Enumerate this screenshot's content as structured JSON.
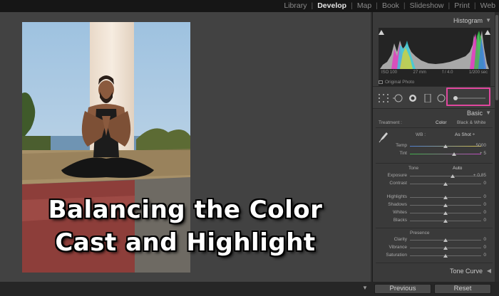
{
  "modules": [
    {
      "label": "Library",
      "active": false
    },
    {
      "label": "Develop",
      "active": true
    },
    {
      "label": "Map",
      "active": false
    },
    {
      "label": "Book",
      "active": false
    },
    {
      "label": "Slideshow",
      "active": false
    },
    {
      "label": "Print",
      "active": false
    },
    {
      "label": "Web",
      "active": false
    }
  ],
  "overlay": {
    "line1": "Balancing the Color",
    "line2": "Cast and Highlight"
  },
  "panel": {
    "histogram_title": "Histogram",
    "exif": {
      "iso": "ISO 100",
      "focal": "27 mm",
      "aperture": "f / 4.0",
      "shutter": "1/200 sec"
    },
    "original_photo": "Original Photo",
    "basic_title": "Basic",
    "treatment_label": "Treatment :",
    "treatment_color": "Color",
    "treatment_bw": "Black & White",
    "wb_label": "WB :",
    "wb_value": "As Shot ÷",
    "tone_label": "Tone",
    "auto_label": "Auto",
    "presence_label": "Presence",
    "tone_curve_title": "Tone Curve",
    "sliders": {
      "temp": {
        "label": "Temp",
        "value": "5000",
        "position": 0.5
      },
      "tint": {
        "label": "Tint",
        "value": "+ 5",
        "position": 0.62
      },
      "exposure": {
        "label": "Exposure",
        "value": "+ 0.85",
        "position": 0.6
      },
      "contrast": {
        "label": "Contrast",
        "value": "0",
        "position": 0.5
      },
      "highlights": {
        "label": "Highlights",
        "value": "0",
        "position": 0.5
      },
      "shadows": {
        "label": "Shadows",
        "value": "0",
        "position": 0.5
      },
      "whites": {
        "label": "Whites",
        "value": "0",
        "position": 0.5
      },
      "blacks": {
        "label": "Blacks",
        "value": "0",
        "position": 0.5
      },
      "clarity": {
        "label": "Clarity",
        "value": "0",
        "position": 0.5
      },
      "vibrance": {
        "label": "Vibrance",
        "value": "0",
        "position": 0.5
      },
      "saturation": {
        "label": "Saturation",
        "value": "0",
        "position": 0.5
      }
    }
  },
  "buttons": {
    "previous": "Previous",
    "reset": "Reset"
  },
  "colors": {
    "highlight_box": "#e0479e",
    "active_module": "#e6e6e6"
  }
}
